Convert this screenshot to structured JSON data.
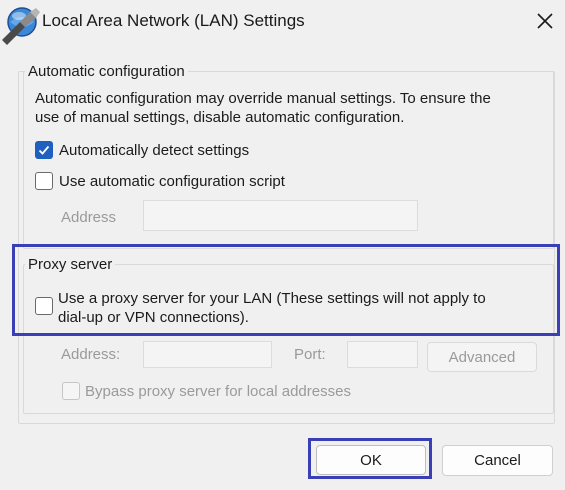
{
  "window": {
    "title": "Local Area Network (LAN) Settings"
  },
  "auto_config": {
    "legend": "Automatic configuration",
    "description_line1": "Automatic configuration may override manual settings.  To ensure the",
    "description_line2": "use of manual settings, disable automatic configuration.",
    "auto_detect_label": "Automatically detect settings",
    "auto_detect_checked": true,
    "script_label": "Use automatic configuration script",
    "script_checked": false,
    "address_label": "Address",
    "address_value": ""
  },
  "proxy": {
    "legend": "Proxy server",
    "use_proxy_line1": "Use a proxy server for your LAN (These settings will not apply to",
    "use_proxy_line2": "dial-up or VPN connections).",
    "use_proxy_checked": false,
    "address_label": "Address:",
    "address_value": "",
    "port_label": "Port:",
    "port_value": "",
    "advanced_label": "Advanced",
    "bypass_label": "Bypass proxy server for local addresses",
    "bypass_checked": false
  },
  "buttons": {
    "ok": "OK",
    "cancel": "Cancel"
  },
  "colors": {
    "accent": "#1f5fbf",
    "highlight": "#3a3fb6"
  },
  "icons": {
    "app": "network-settings-icon",
    "close": "close-icon",
    "check": "checkmark-icon"
  }
}
